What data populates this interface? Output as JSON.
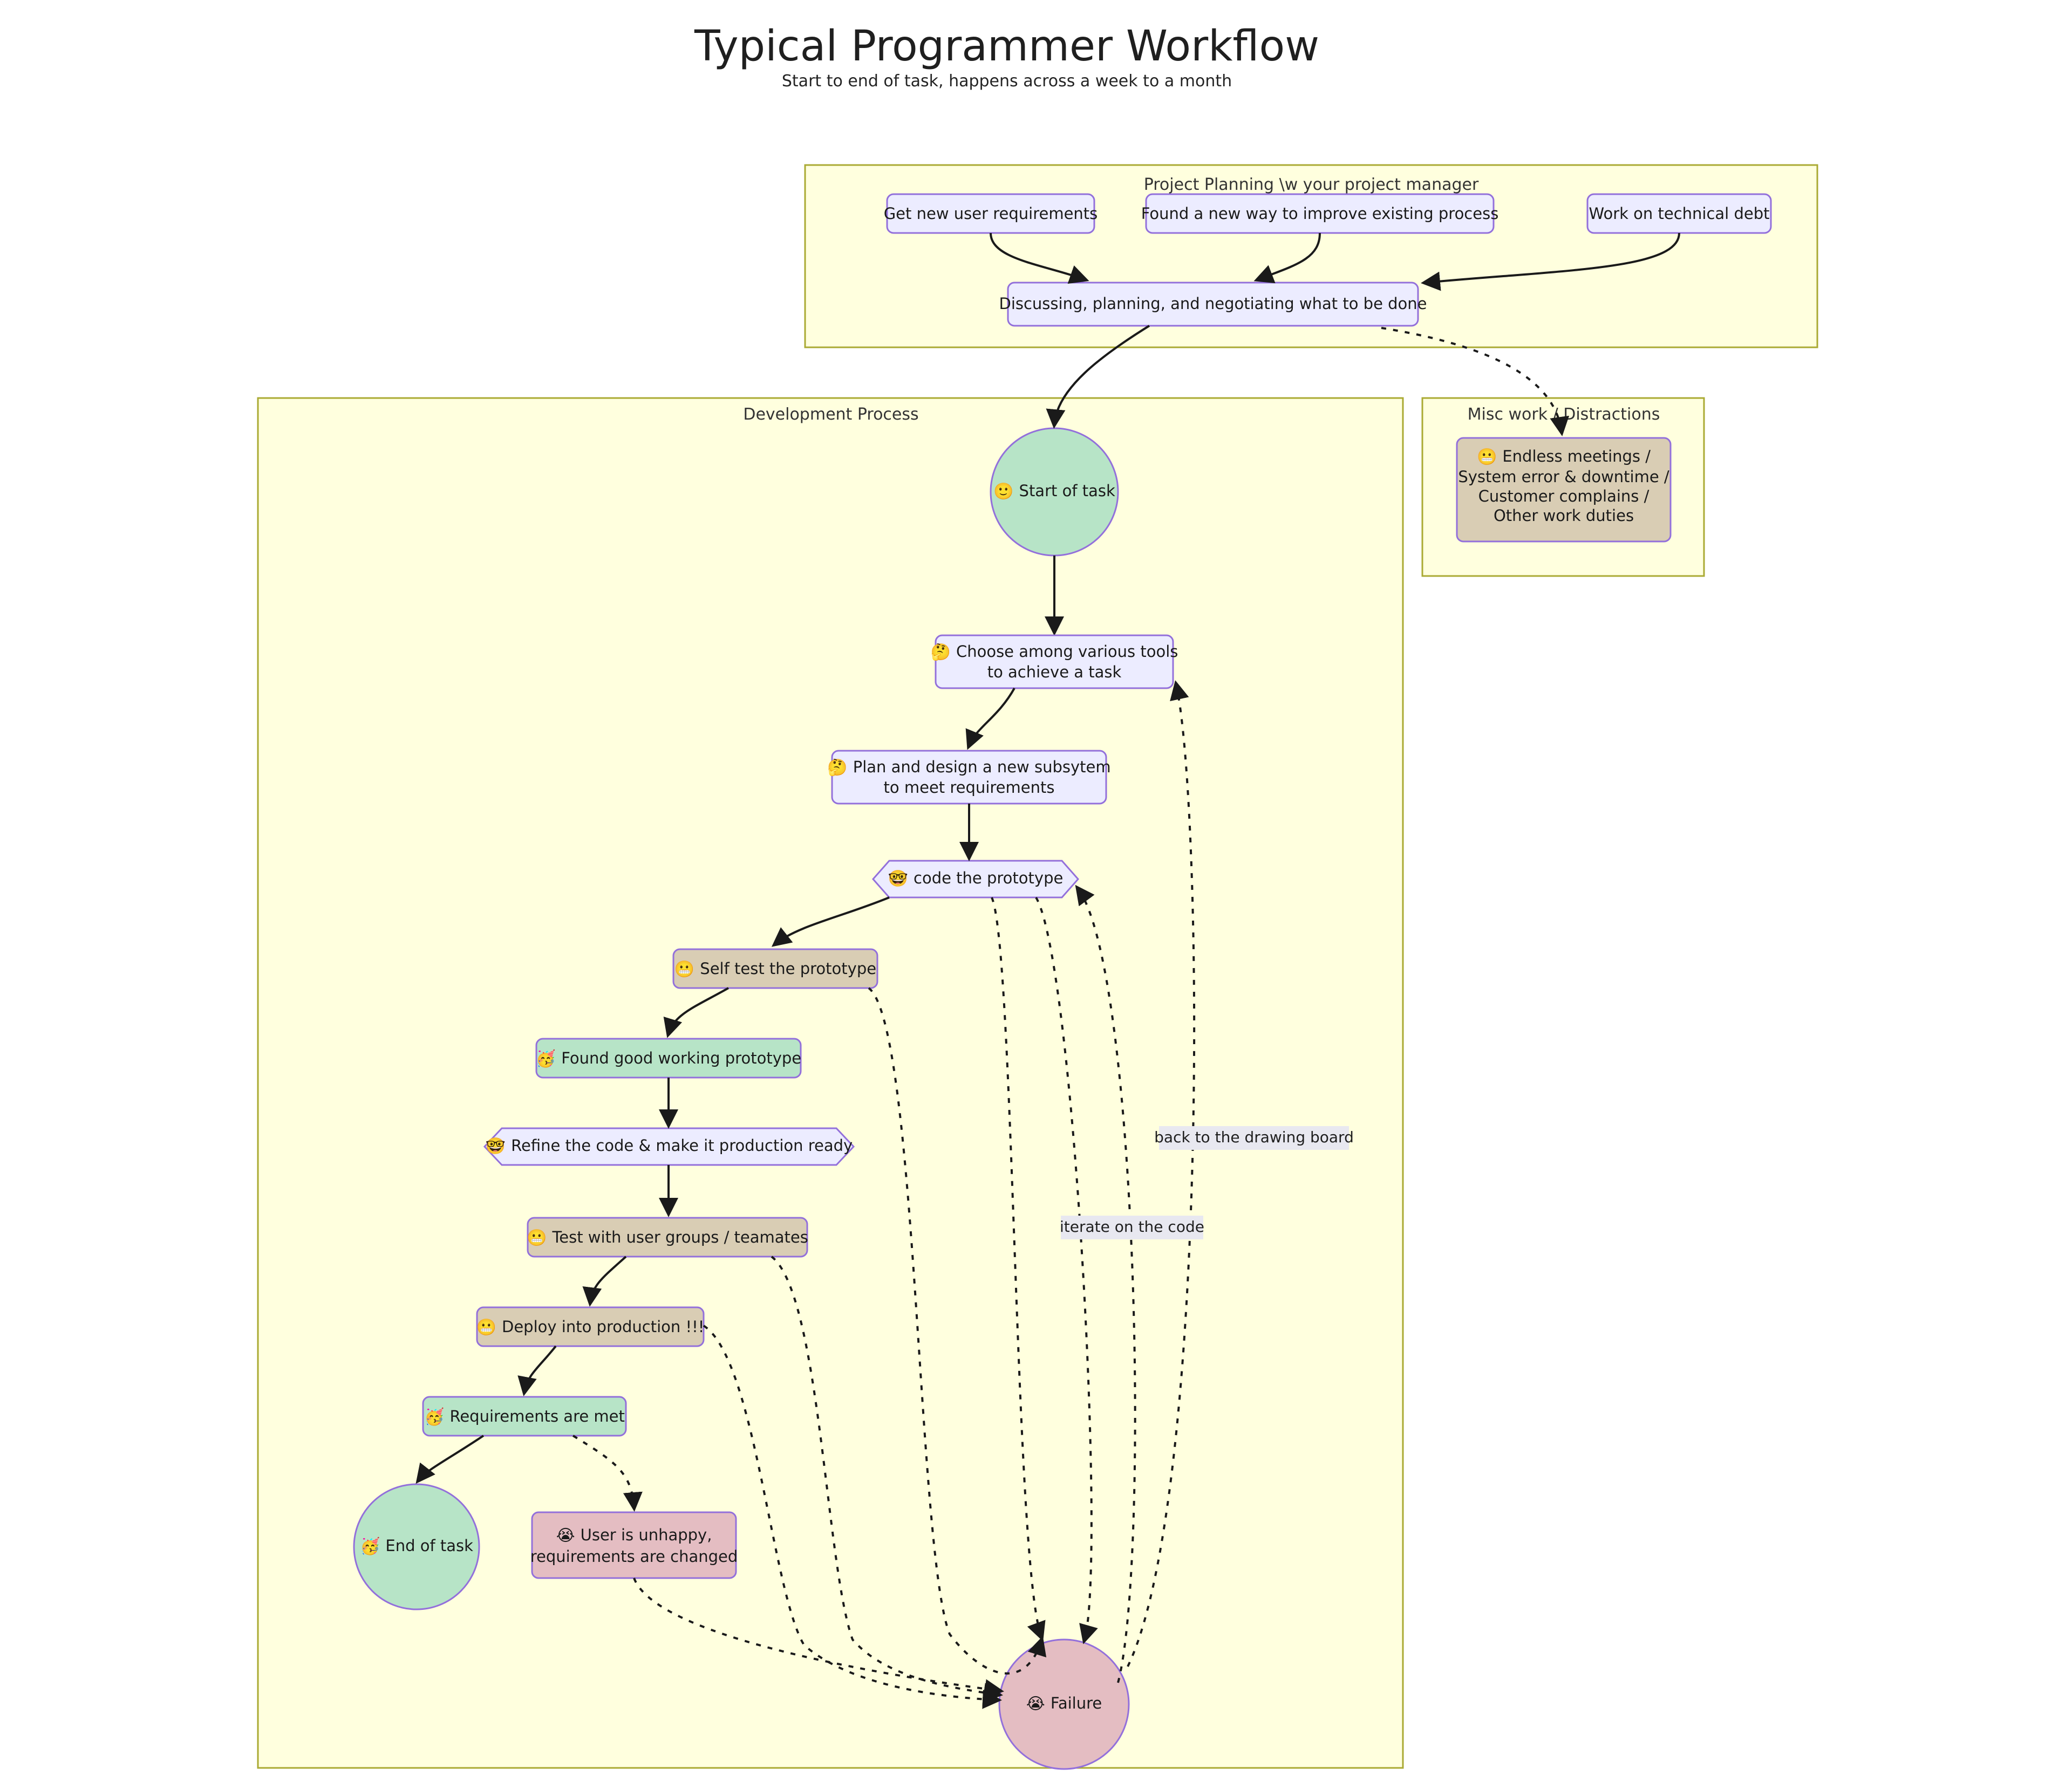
{
  "header": {
    "title": "Typical Programmer Workflow",
    "subtitle": "Start to end of task, happens across a week to a month"
  },
  "subgraphs": [
    {
      "id": "planning",
      "label": "Project Planning \\w your project manager"
    },
    {
      "id": "development",
      "label": "Development Process"
    },
    {
      "id": "misc",
      "label": "Misc work / Distractions"
    }
  ],
  "nodes": {
    "get_req": {
      "label": "Get new user requirements",
      "emoji": "",
      "shape": "rect",
      "style": "process"
    },
    "new_way": {
      "label": "Found a new way to improve existing process",
      "emoji": "",
      "shape": "rect",
      "style": "process"
    },
    "tech_debt": {
      "label": "Work on technical debt",
      "emoji": "",
      "shape": "rect",
      "style": "process"
    },
    "discussing": {
      "label": "Discussing, planning, and negotiating what to be done",
      "emoji": "",
      "shape": "rect",
      "style": "process"
    },
    "misc_work": {
      "label_line1": "Endless meetings /",
      "label_line2": "System error & downtime /",
      "label_line3": "Customer complains /",
      "label_line4": "Other work duties",
      "emoji": "😬",
      "shape": "rect",
      "style": "tan"
    },
    "start": {
      "label": "Start of task",
      "emoji": "🙂",
      "shape": "circle",
      "style": "green"
    },
    "choose_tools": {
      "label_line1": "Choose among various tools",
      "label_line2": "to achieve a task",
      "emoji": "🤔",
      "shape": "rect",
      "style": "process"
    },
    "plan_design": {
      "label_line1": "Plan and design a new subsytem",
      "label_line2": "to meet requirements",
      "emoji": "🤔",
      "shape": "rect",
      "style": "process"
    },
    "code_proto": {
      "label": "code the prototype",
      "emoji": "🤓",
      "shape": "hexagon",
      "style": "process"
    },
    "self_test": {
      "label": "Self test the prototype",
      "emoji": "😬",
      "shape": "rect",
      "style": "tan"
    },
    "good_proto": {
      "label": "Found good working prototype",
      "emoji": "🥳",
      "shape": "rect",
      "style": "green"
    },
    "refine": {
      "label": "Refine the code & make it production ready",
      "emoji": "🤓",
      "shape": "hexagon",
      "style": "process"
    },
    "test_users": {
      "label": "Test with user groups / teamates",
      "emoji": "😬",
      "shape": "rect",
      "style": "tan"
    },
    "deploy": {
      "label": "Deploy into production !!!",
      "emoji": "😬",
      "shape": "rect",
      "style": "tan"
    },
    "req_met": {
      "label": "Requirements are met",
      "emoji": "🥳",
      "shape": "rect",
      "style": "green"
    },
    "end_task": {
      "label": "End of task",
      "emoji": "🥳",
      "shape": "circle",
      "style": "green"
    },
    "user_unhappy": {
      "label_line1": "User is unhappy,",
      "label_line2": "requirements are changed",
      "emoji": "😭",
      "shape": "rect",
      "style": "pink"
    },
    "failure": {
      "label": "Failure",
      "emoji": "😭",
      "shape": "circle",
      "style": "pink"
    }
  },
  "edge_labels": {
    "back_to_drawing_board": "back to the drawing board",
    "iterate_on_the_code": "iterate on the code"
  },
  "colors": {
    "subgraph_fill": "#ffffde",
    "subgraph_stroke": "#aaaa33",
    "process_fill": "#ececff",
    "node_stroke": "#9370db",
    "green_fill": "#b7e4c7",
    "tan_fill": "#d9cdb4",
    "pink_fill": "#e4bdc2",
    "edge_stroke": "#1a1a1a",
    "page_bg": "#ffffff"
  }
}
